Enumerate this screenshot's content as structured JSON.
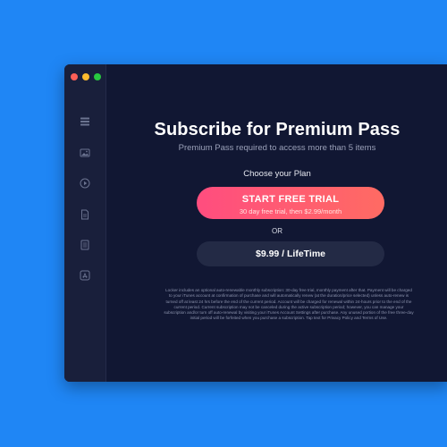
{
  "colors": {
    "background": "#1f86f5",
    "window": "#111733",
    "sidebar": "#191f3b",
    "accent_gradient_start": "#ff4d7f",
    "accent_gradient_end": "#ff6b63",
    "secondary_button": "#232a45"
  },
  "window_controls": [
    "close",
    "minimize",
    "zoom"
  ],
  "sidebar": {
    "icons": [
      "list-icon",
      "image-icon",
      "play-icon",
      "document-icon",
      "notes-icon",
      "app-store-icon"
    ]
  },
  "main": {
    "title": "Subscribe for Premium Pass",
    "subtitle": "Premium Pass required to access more than 5 items",
    "choose_label": "Choose your Plan",
    "trial_button": {
      "label": "START FREE TRIAL",
      "sublabel": "30 day free trial, then $2.99/month"
    },
    "or_label": "OR",
    "lifetime_button": {
      "label": "$9.99 / LifeTime"
    },
    "legal_text": "Locker includes an optional auto-renewable monthly subscription: 30-day free trial, monthly payment after that. Payment will be charged to your iTunes account at confirmation of purchase and will automatically renew (at the duration/price selected) unless auto-renew is turned off at least 24 hrs before the end of the current period. Account will be charged for renewal within 24-hours prior to the end of the current period. Current subscription may not be canceled during the active subscription period; however, you can manage your subscription and/or turn off auto-renewal by visiting your iTunes Account Settings after purchase. Any unused portion of the free three-day initial period will be forfeited when you purchase a subscription. Tap text for Privacy Policy and Terms of Use."
  }
}
